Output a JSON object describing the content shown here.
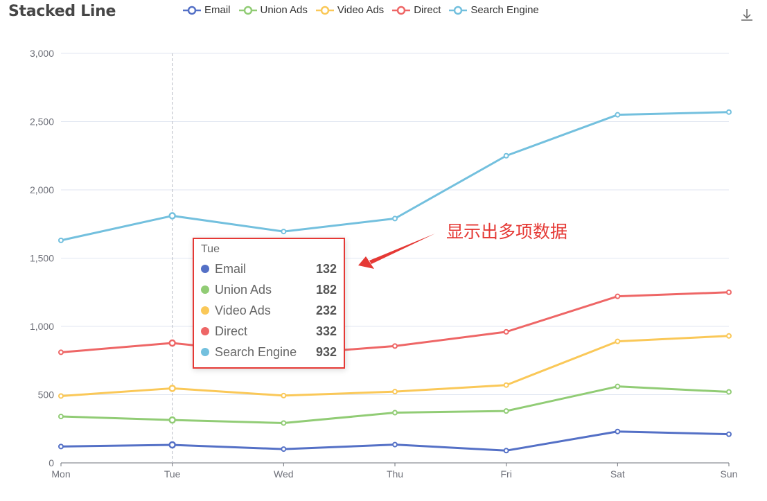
{
  "chart_data": {
    "type": "line",
    "title": "Stacked Line",
    "categories": [
      "Mon",
      "Tue",
      "Wed",
      "Thu",
      "Fri",
      "Sat",
      "Sun"
    ],
    "series": [
      {
        "name": "Email",
        "color": "#5470c6",
        "values": [
          120,
          132,
          101,
          134,
          90,
          230,
          210
        ]
      },
      {
        "name": "Union Ads",
        "color": "#91cc75",
        "values": [
          220,
          182,
          191,
          234,
          290,
          330,
          310
        ]
      },
      {
        "name": "Video Ads",
        "color": "#fac858",
        "values": [
          150,
          232,
          201,
          154,
          190,
          330,
          410
        ]
      },
      {
        "name": "Direct",
        "color": "#ee6666",
        "values": [
          320,
          332,
          301,
          334,
          390,
          330,
          320
        ]
      },
      {
        "name": "Search Engine",
        "color": "#73c0de",
        "values": [
          820,
          932,
          901,
          934,
          1290,
          1330,
          1320
        ]
      }
    ],
    "stacked": true,
    "y_ticks": [
      "0",
      "500",
      "1,000",
      "1,500",
      "2,000",
      "2,500",
      "3,000"
    ],
    "ylim": [
      0,
      3000
    ],
    "grid": true,
    "legend_position": "top-center"
  },
  "tooltip": {
    "header": "Tue",
    "rows": [
      {
        "name": "Email",
        "value": "132",
        "color": "#5470c6"
      },
      {
        "name": "Union Ads",
        "value": "182",
        "color": "#91cc75"
      },
      {
        "name": "Video Ads",
        "value": "232",
        "color": "#fac858"
      },
      {
        "name": "Direct",
        "value": "332",
        "color": "#ee6666"
      },
      {
        "name": "Search Engine",
        "value": "932",
        "color": "#73c0de"
      }
    ]
  },
  "annotation": {
    "text": "显示出多项数据",
    "color": "#e53935"
  },
  "toolbar": {
    "save_icon": "download-icon"
  }
}
